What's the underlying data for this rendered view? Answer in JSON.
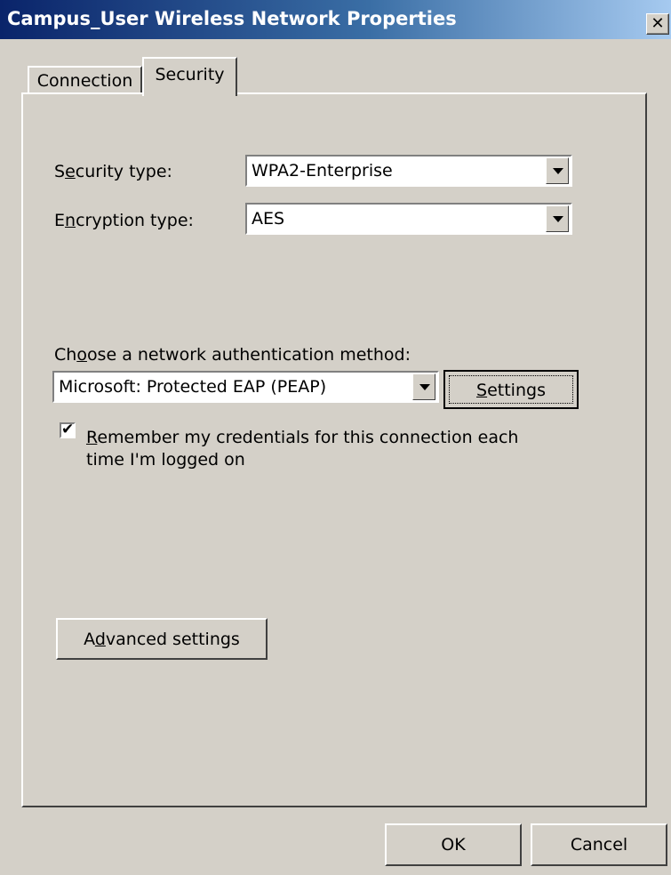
{
  "window": {
    "title": "Campus_User Wireless Network Properties",
    "close_glyph": "✕",
    "title_gradient": [
      "#0a246a",
      "#a6caf0"
    ],
    "face_color": "#d4d0c8"
  },
  "tabs": [
    {
      "label": "Connection",
      "selected": false
    },
    {
      "label": "Security",
      "selected": true
    }
  ],
  "security_type": {
    "label_pre": "S",
    "label_accel": "e",
    "label_post": "curity type:",
    "value": "WPA2-Enterprise"
  },
  "encryption_type": {
    "label_pre": "E",
    "label_accel": "n",
    "label_post": "cryption type:",
    "value": "AES"
  },
  "auth_method": {
    "label_pre": "Ch",
    "label_accel": "o",
    "label_post": "ose a network authentication method:",
    "value": "Microsoft: Protected EAP (PEAP)"
  },
  "settings_button": {
    "accel": "S",
    "label_post": "ettings"
  },
  "remember_credentials": {
    "checked": true,
    "check_glyph": "✔",
    "accel": "R",
    "line1_post": "emember my credentials for this connection each",
    "line2": "time I'm logged on"
  },
  "advanced_button": {
    "label_pre": "A",
    "accel": "d",
    "label_post": "vanced settings"
  },
  "footer": {
    "ok_label": "OK",
    "cancel_label": "Cancel"
  },
  "icons": {
    "dropdown": "chevron-down-icon",
    "close": "close-icon",
    "check": "checkmark-icon"
  }
}
